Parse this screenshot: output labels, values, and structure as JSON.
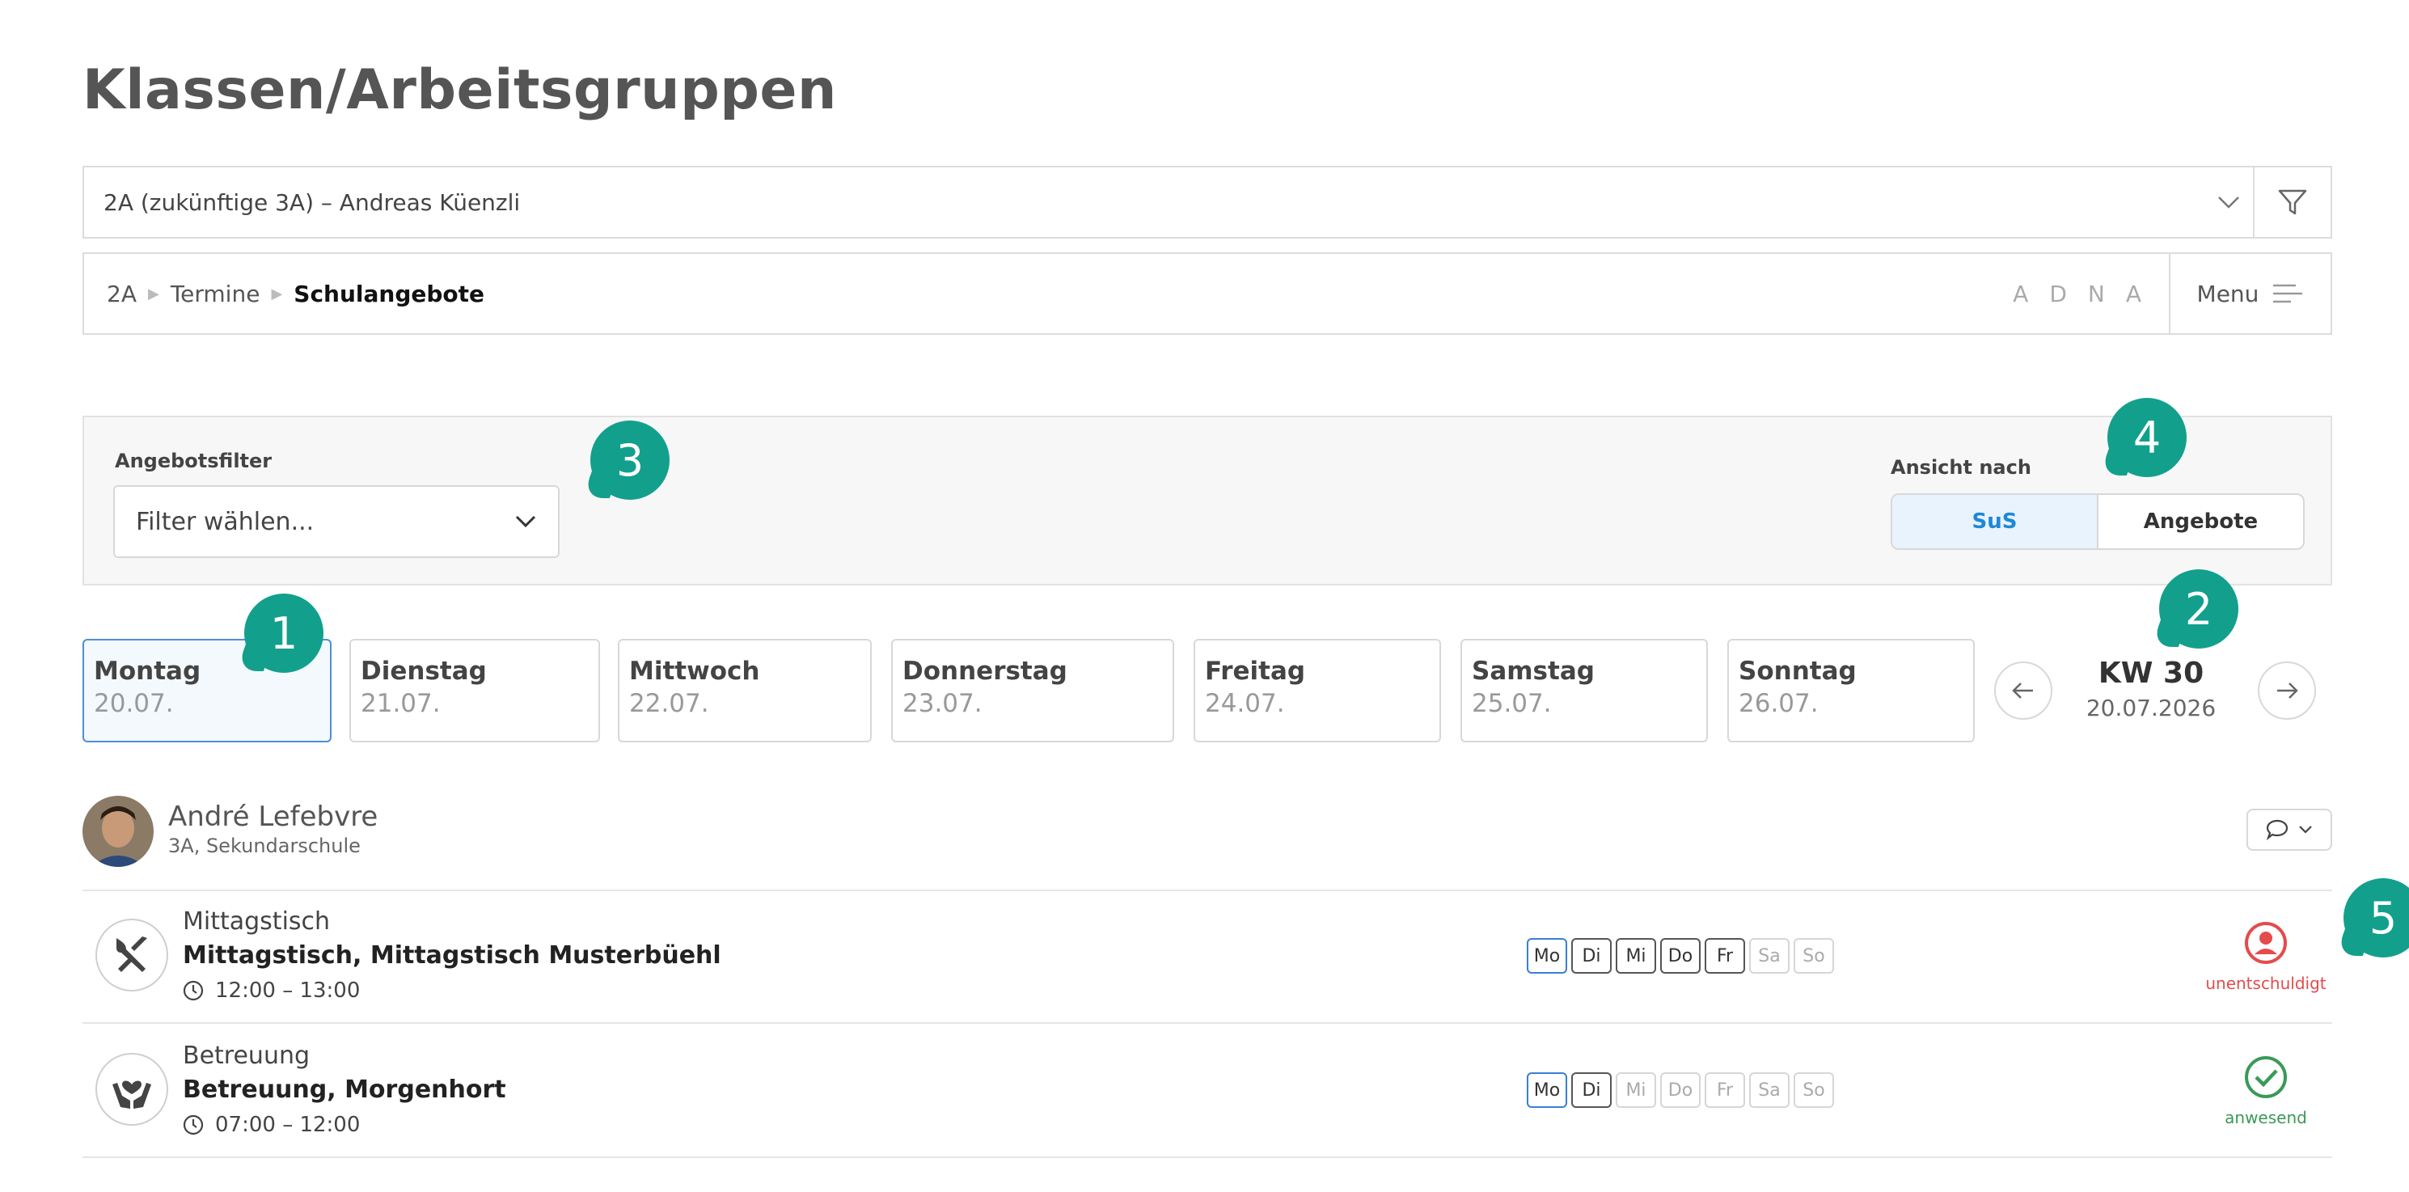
{
  "page": {
    "title": "Klassen/Arbeitsgruppen"
  },
  "class_select": {
    "value": "2A (zukünftige 3A) – Andreas Küenzli"
  },
  "breadcrumb": {
    "items": [
      "2A",
      "Termine",
      "Schulangebote"
    ]
  },
  "adna": [
    "A",
    "D",
    "N",
    "A"
  ],
  "menu": {
    "label": "Menu"
  },
  "filter_panel": {
    "label": "Angebotsfilter",
    "placeholder": "Filter wählen...",
    "view_label": "Ansicht nach",
    "view_options": [
      "SuS",
      "Angebote"
    ],
    "view_selected": "SuS"
  },
  "callouts": [
    "1",
    "2",
    "3",
    "4",
    "5"
  ],
  "week": {
    "days": [
      {
        "name": "Montag",
        "date": "20.07."
      },
      {
        "name": "Dienstag",
        "date": "21.07."
      },
      {
        "name": "Mittwoch",
        "date": "22.07."
      },
      {
        "name": "Donnerstag",
        "date": "23.07."
      },
      {
        "name": "Freitag",
        "date": "24.07."
      },
      {
        "name": "Samstag",
        "date": "25.07."
      },
      {
        "name": "Sonntag",
        "date": "26.07."
      }
    ],
    "selected_day": "Montag",
    "kw": "KW 30",
    "kw_date": "20.07.2026"
  },
  "person": {
    "name": "André Lefebvre",
    "subtitle": "3A, Sekundarschule"
  },
  "offers": [
    {
      "category": "Mittagstisch",
      "title": "Mittagstisch, Mittagstisch Musterbüehl",
      "time": "12:00 – 13:00",
      "icon": "cutlery-icon",
      "days": [
        "Mo",
        "Di",
        "Mi",
        "Do",
        "Fr",
        "Sa",
        "So"
      ],
      "active_days": [
        "Mo",
        "Di",
        "Mi",
        "Do",
        "Fr"
      ],
      "status": "unentschuldigt",
      "status_color": "#e54b4b"
    },
    {
      "category": "Betreuung",
      "title": "Betreuung, Morgenhort",
      "time": "07:00 – 12:00",
      "icon": "caring-hands-icon",
      "days": [
        "Mo",
        "Di",
        "Mi",
        "Do",
        "Fr",
        "Sa",
        "So"
      ],
      "active_days": [
        "Mo",
        "Di"
      ],
      "status": "anwesend",
      "status_color": "#3a9a57"
    }
  ]
}
